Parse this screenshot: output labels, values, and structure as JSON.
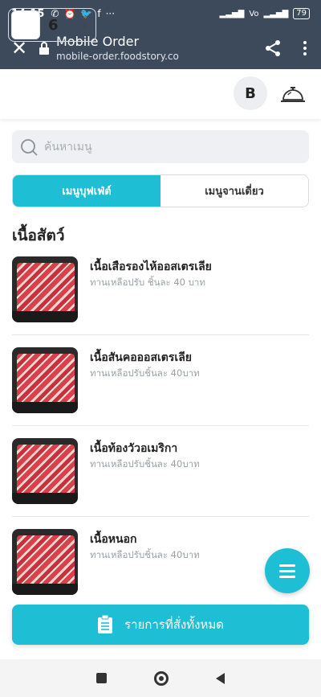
{
  "status_bar": {
    "time": "14:15",
    "battery": "79",
    "icons": [
      "missed-call-icon",
      "alarm-icon",
      "twitter-icon",
      "facebook-icon",
      "more-dots-icon",
      "signal-icon",
      "volte-icon",
      "signal-icon"
    ]
  },
  "browser": {
    "title": "Mobile Order",
    "url": "mobile-order.foodstory.co"
  },
  "header": {
    "table_number": "6",
    "avatar_letter": "B"
  },
  "search": {
    "placeholder": "ค้นหาเมนู"
  },
  "tabs": [
    {
      "label": "เมนูบุฟเฟ่ต์",
      "active": true
    },
    {
      "label": "เมนูจานเดี่ยว",
      "active": false
    }
  ],
  "category": "เนื้อสัตว์",
  "items": [
    {
      "name": "เนื้อเสือรองไห้ออสเตรเลีย",
      "desc": "ทานเหลือปรับ ชิ้นละ 40 บาท"
    },
    {
      "name": "เนื้อสันคอออสเตรเลีย",
      "desc": "ทานเหลือปรับชิ้นละ 40บาท"
    },
    {
      "name": "เนื้อท้องวัวอเมริกา",
      "desc": "ทานเหลือปรับชิ้นละ 40บาท"
    },
    {
      "name": "เนื้อหนอก",
      "desc": "ทานเหลือปรับชิ้นละ 40บาท"
    }
  ],
  "order_button": {
    "label": "รายการที่สั่งทั้งหมด"
  },
  "colors": {
    "accent": "#1ebfd4",
    "topbar": "#3d4a5c"
  }
}
